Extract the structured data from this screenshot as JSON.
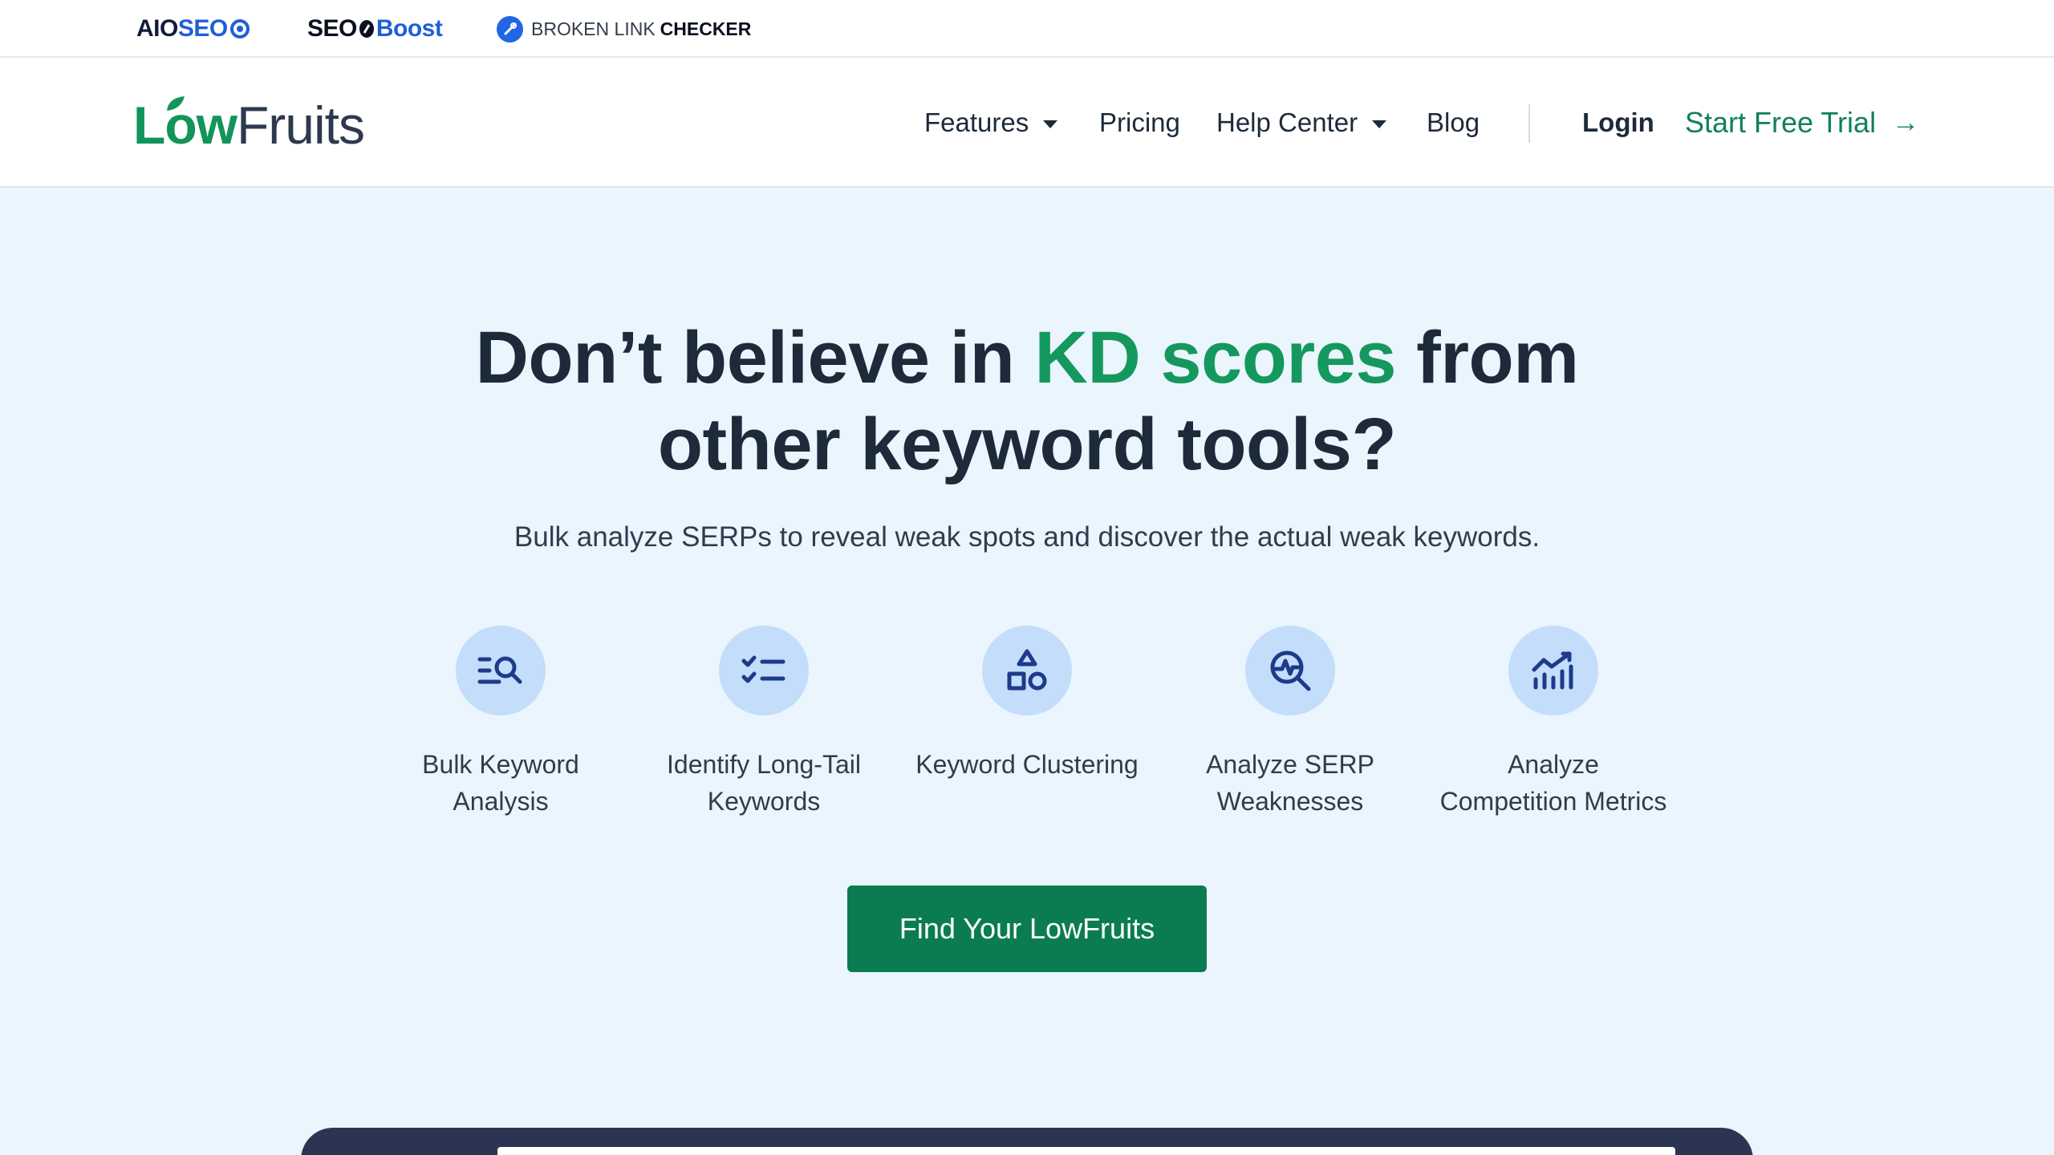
{
  "topbar": {
    "brands": [
      {
        "part_a": "AIO",
        "part_b": "SEO",
        "icon": "gear-icon"
      },
      {
        "part_a": "SEO",
        "part_b": "Boost",
        "icon": "rocket-icon"
      },
      {
        "part_a": "BROKEN LINK",
        "part_b": "CHECKER",
        "icon": "link-icon"
      }
    ]
  },
  "navbar": {
    "logo": {
      "part_a": "Low",
      "part_b": "Fruits",
      "icon": "fruit-leaf-icon"
    },
    "items": [
      {
        "label": "Features",
        "has_dropdown": true
      },
      {
        "label": "Pricing",
        "has_dropdown": false
      },
      {
        "label": "Help Center",
        "has_dropdown": true
      },
      {
        "label": "Blog",
        "has_dropdown": false
      }
    ],
    "login": "Login",
    "trial": "Start Free Trial",
    "trial_arrow": "→"
  },
  "hero": {
    "title_pre": "Don’t believe in ",
    "title_highlight": "KD scores",
    "title_post": " from",
    "title_line2": "other keyword tools?",
    "subtitle": "Bulk analyze SERPs to reveal weak spots and discover the actual weak keywords."
  },
  "features": [
    {
      "line1": "Bulk Keyword",
      "line2": "Analysis",
      "icon": "list-search-icon"
    },
    {
      "line1": "Identify Long-Tail",
      "line2": "Keywords",
      "icon": "checklist-icon"
    },
    {
      "line1": "Keyword Clustering",
      "line2": "",
      "icon": "shapes-icon"
    },
    {
      "line1": "Analyze SERP",
      "line2": "Weaknesses",
      "icon": "search-pulse-icon"
    },
    {
      "line1": "Analyze",
      "line2": "Competition Metrics",
      "icon": "chart-trend-icon"
    }
  ],
  "cta": {
    "label": "Find Your LowFruits"
  },
  "colors": {
    "accent": "#15985d",
    "cta": "#0b7c52",
    "icon_blue": "#1e3a8a",
    "hero_bg": "#eaf5fd"
  }
}
